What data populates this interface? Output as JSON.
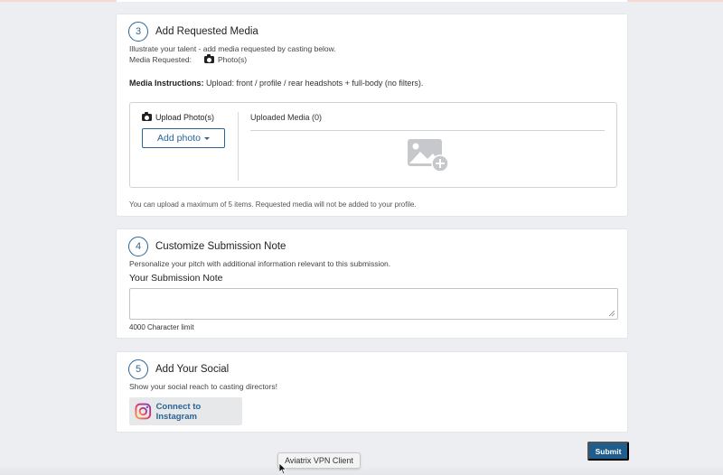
{
  "sections": {
    "media": {
      "step": "3",
      "title": "Add Requested Media",
      "description": "Illustrate your talent - add media requested by casting below.",
      "requested_label": "Media Requested:",
      "requested_value": "Photo(s)",
      "instructions_label": "Media Instructions:",
      "instructions_text": " Upload: front / profile / rear headshots + full-body (no filters).",
      "upload_title": "Upload Photo(s)",
      "add_photo_label": "Add photo",
      "uploaded_title": "Uploaded Media (0)",
      "limit_note": "You can upload a maximum of 5 items. Requested media will not be added to your profile."
    },
    "note": {
      "step": "4",
      "title": "Customize Submission Note",
      "description": "Personalize your pitch with additional information relevant to this submission.",
      "field_label": "Your Submission Note",
      "value": "",
      "char_limit": "4000 Character limit"
    },
    "social": {
      "step": "5",
      "title": "Add Your Social",
      "description": "Show your social reach to casting directors!",
      "connect_label": "Connect to Instagram"
    }
  },
  "submit_label": "Submit",
  "tooltip": "Aviatrix VPN Client",
  "colors": {
    "accent": "#2a6496",
    "submit": "#1f5d8c",
    "background": "#eceef1"
  },
  "icons": {
    "camera": "camera-icon",
    "image_add": "image-add-icon",
    "instagram": "instagram-icon",
    "cursor": "mouse-cursor-icon"
  }
}
